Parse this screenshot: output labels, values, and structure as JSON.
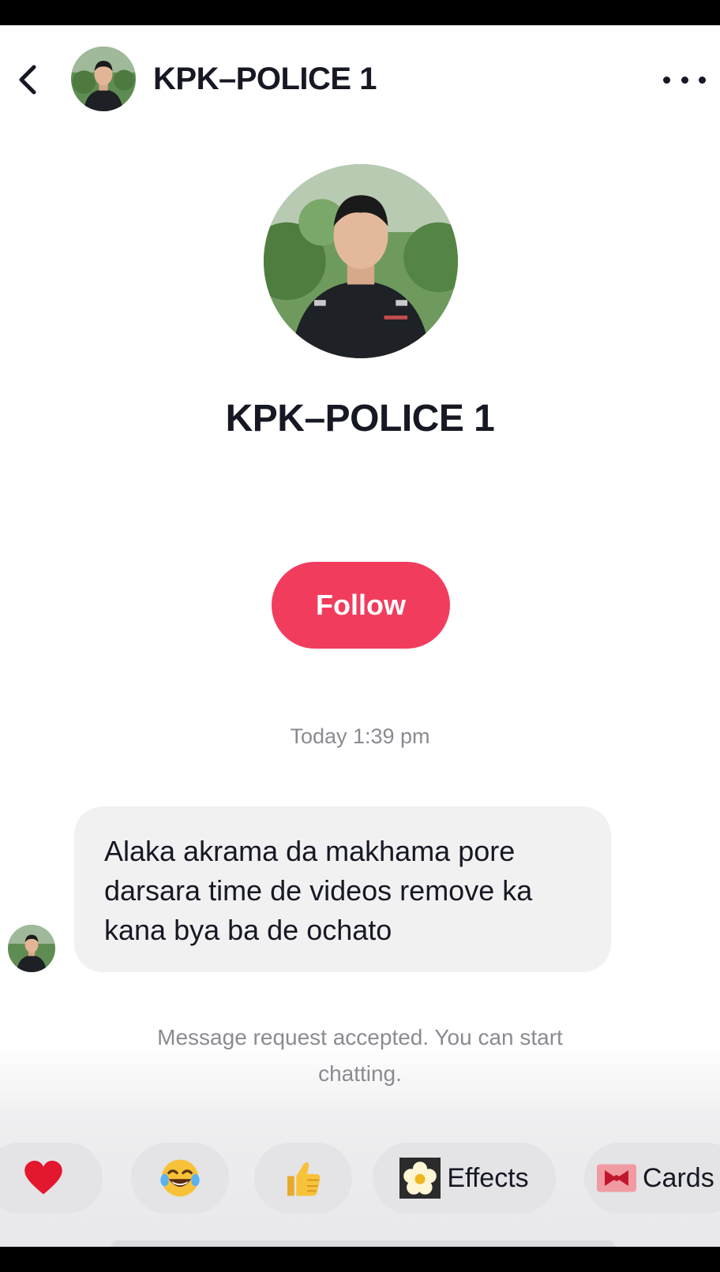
{
  "header": {
    "title": "KPK–POLICE 1",
    "back_icon": "chevron-left-icon",
    "more_icon": "more-horizontal-icon"
  },
  "profile": {
    "name": "KPK–POLICE 1",
    "follow_label": "Follow",
    "follow_color": "#f23c5e"
  },
  "conversation": {
    "timestamp": "Today 1:39 pm",
    "messages": [
      {
        "from": "KPK–POLICE 1",
        "text": "Alaka akrama da makhama pore darsara time de videos remove ka kana bya ba de ochato"
      }
    ],
    "system_message": "Message request accepted. You can start chatting."
  },
  "quick_replies": [
    {
      "icon": "red-heart-icon"
    },
    {
      "icon": "tears-of-joy-icon"
    },
    {
      "icon": "thumbs-up-icon"
    },
    {
      "icon": "flower-effects-icon",
      "label": "Effects"
    },
    {
      "icon": "gift-card-icon",
      "label": "Cards"
    }
  ]
}
